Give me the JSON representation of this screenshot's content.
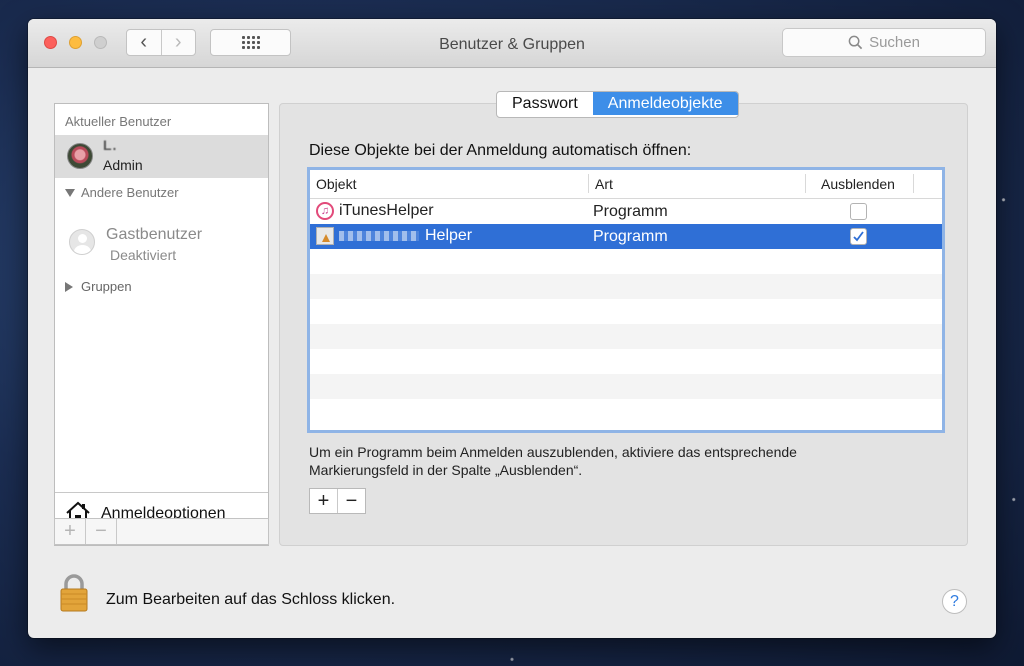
{
  "window": {
    "title": "Benutzer & Gruppen"
  },
  "toolbar": {
    "back_glyph": "‹",
    "forward_glyph": "›",
    "search_placeholder": "Suchen"
  },
  "sidebar": {
    "current_header": "Aktueller Benutzer",
    "current_user": {
      "name": "L.",
      "role": "Admin"
    },
    "other_header": "Andere Benutzer",
    "guest": {
      "name": "Gastbenutzer",
      "status": "Deaktiviert"
    },
    "groups_label": "Gruppen",
    "login_options_label": "Anmeldeoptionen",
    "add_glyph": "+",
    "remove_glyph": "−"
  },
  "tabs": [
    {
      "label": "Passwort",
      "active": false
    },
    {
      "label": "Anmeldeobjekte",
      "active": true
    }
  ],
  "login_items": {
    "intro": "Diese Objekte bei der Anmeldung automatisch öffnen:",
    "columns": [
      "Objekt",
      "Art",
      "Ausblenden"
    ],
    "rows": [
      {
        "name": "iTunesHelper",
        "kind": "Programm",
        "hidden": false,
        "selected": false,
        "icon": "itunes-icon"
      },
      {
        "name": "Helper",
        "kind": "Programm",
        "hidden": true,
        "selected": true,
        "icon": "app-icon"
      }
    ],
    "hint": "Um ein Programm beim Anmelden auszublenden, aktiviere das entsprechende Markierungsfeld in der Spalte „Ausblenden“.",
    "add_glyph": "+",
    "remove_glyph": "−"
  },
  "footer": {
    "lock_label": "Zum Bearbeiten auf das Schloss klicken.",
    "help_glyph": "?"
  },
  "colors": {
    "accent": "#3d8ee8",
    "selection": "#2f6fd6",
    "close": "#fc605c",
    "minimize": "#fdbc40"
  }
}
